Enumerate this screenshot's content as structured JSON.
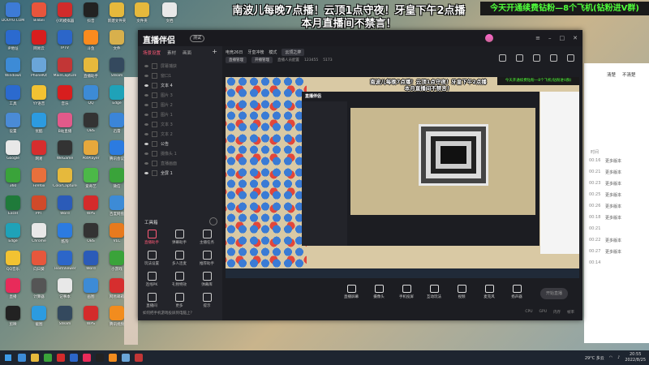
{
  "desktop": {
    "icons": [
      {
        "label": "DOUYU.COM",
        "color": "#3d7bd6"
      },
      {
        "label": "Bilibili",
        "color": "#e8553c"
      },
      {
        "label": "小鸡模拟器",
        "color": "#d12b2b"
      },
      {
        "label": "抖音",
        "color": "#222"
      },
      {
        "label": "新建文件夹",
        "color": "#e6b93c"
      },
      {
        "label": "IP地址",
        "color": "#2b6acf"
      },
      {
        "label": "网易云",
        "color": "#d81e1e"
      },
      {
        "label": "IPTV",
        "color": "#2c66c9"
      },
      {
        "label": "斗鱼",
        "color": "#fb8b1e"
      },
      {
        "label": "文件",
        "color": "#d8b04c"
      },
      {
        "label": "Windows",
        "color": "#3d8bd6"
      },
      {
        "label": "PhoneKit",
        "color": "#6aa5d8"
      },
      {
        "label": "MainCapture",
        "color": "#c23636"
      },
      {
        "label": "直播助手",
        "color": "#e6b93c"
      },
      {
        "label": "Steam",
        "color": "#34495e"
      },
      {
        "label": "工具",
        "color": "#2b6acf"
      },
      {
        "label": "YY语音",
        "color": "#f2c232"
      },
      {
        "label": "音乐",
        "color": "#d81e1e"
      },
      {
        "label": "QQ",
        "color": "#3d8bd6"
      },
      {
        "label": "Edge",
        "color": "#1fa2b8"
      },
      {
        "label": "设置",
        "color": "#4a8bd6"
      },
      {
        "label": "优酷",
        "color": "#2c9be0"
      },
      {
        "label": "B站直播",
        "color": "#e25a8a"
      },
      {
        "label": "OBS",
        "color": "#333"
      },
      {
        "label": "迅雷",
        "color": "#3b85d8"
      },
      {
        "label": "Google",
        "color": "#e8e8e8"
      },
      {
        "label": "网易",
        "color": "#d62e2e"
      },
      {
        "label": "WeGame",
        "color": "#333"
      },
      {
        "label": "PotPlayer",
        "color": "#e6a83c"
      },
      {
        "label": "腾讯会议",
        "color": "#2c7be0"
      },
      {
        "label": "360",
        "color": "#3aa33a"
      },
      {
        "label": "Firefox",
        "color": "#e8703c"
      },
      {
        "label": "ColorCapture",
        "color": "#e6b93c"
      },
      {
        "label": "爱奇艺",
        "color": "#4cb848"
      },
      {
        "label": "微信",
        "color": "#3aa33a"
      },
      {
        "label": "Excel",
        "color": "#1f7a3a"
      },
      {
        "label": "PPT",
        "color": "#d04a2a"
      },
      {
        "label": "Word",
        "color": "#2b5bb8"
      },
      {
        "label": "WPS",
        "color": "#d42b2b"
      },
      {
        "label": "百度网盘",
        "color": "#3d8bd6"
      },
      {
        "label": "Edge",
        "color": "#1fa2b8"
      },
      {
        "label": "Chrome",
        "color": "#e8e8e8"
      },
      {
        "label": "酷狗",
        "color": "#2c7be0"
      },
      {
        "label": "OBS",
        "color": "#333"
      },
      {
        "label": "VLC",
        "color": "#e87a1e"
      },
      {
        "label": "QQ音乐",
        "color": "#f2c232"
      },
      {
        "label": "向日葵",
        "color": "#e6573c"
      },
      {
        "label": "TeamViewer",
        "color": "#2c66c9"
      },
      {
        "label": "Word",
        "color": "#2b5bb8"
      },
      {
        "label": "小游戏",
        "color": "#3aa33a"
      },
      {
        "label": "直播",
        "color": "#e82b5a"
      },
      {
        "label": "计算器",
        "color": "#555"
      },
      {
        "label": "记事本",
        "color": "#e8e8e8"
      },
      {
        "label": "画图",
        "color": "#3d8bd6"
      },
      {
        "label": "网易邮箱",
        "color": "#d62e2e"
      },
      {
        "label": "剪映",
        "color": "#222"
      },
      {
        "label": "截图",
        "color": "#2c9be0"
      },
      {
        "label": "Steam",
        "color": "#34495e"
      },
      {
        "label": "WPS",
        "color": "#d42b2b"
      },
      {
        "label": "腾讯视频",
        "color": "#f28c1e"
      }
    ],
    "top_icons": [
      {
        "label": "文件夹",
        "color": "#e6b93c"
      },
      {
        "label": "文档",
        "color": "#e8e8e8"
      }
    ]
  },
  "banner": {
    "line1": "南波儿每晚7点播！云顶1点守夜！牙皇下午2点播",
    "line2": "本月直播间不禁言！",
    "green": "今天开通续费钻粉—8个飞机(钻粉进V群)"
  },
  "side_panel": {
    "tabs": [
      "清楚",
      "不清楚"
    ],
    "label": "时间",
    "rows": [
      {
        "time": "00:16",
        "text": "更多版本"
      },
      {
        "time": "00:21",
        "text": "更多版本"
      },
      {
        "time": "00:23",
        "text": "更多版本"
      },
      {
        "time": "00:25",
        "text": "更多版本"
      },
      {
        "time": "00:26",
        "text": "更多版本"
      },
      {
        "time": "00:18",
        "text": "更多版本"
      },
      {
        "time": "00:21",
        "text": ""
      },
      {
        "time": "00:22",
        "text": "更多版本"
      },
      {
        "time": "00:27",
        "text": "更多版本"
      },
      {
        "time": "00:14",
        "text": ""
      }
    ]
  },
  "app": {
    "logo": "直播伴侣",
    "badge": "测试",
    "scene_tabs": [
      "场景设置",
      "素材",
      "画面"
    ],
    "scenes": [
      {
        "label": "屏幕捕获",
        "on": false
      },
      {
        "label": "窗口1",
        "on": false
      },
      {
        "label": "文本 4",
        "on": true
      },
      {
        "label": "图片 3",
        "on": false
      },
      {
        "label": "图片 2",
        "on": false
      },
      {
        "label": "图片 1",
        "on": false
      },
      {
        "label": "文本 3",
        "on": false
      },
      {
        "label": "文本 2",
        "on": false
      },
      {
        "label": "公告",
        "on": true
      },
      {
        "label": "摄像头 1",
        "on": false
      },
      {
        "label": "直播画面",
        "on": false
      },
      {
        "label": "全屏 1",
        "on": true
      }
    ],
    "tools_title": "工具箱",
    "tools": [
      {
        "label": "直播助手",
        "hot": true
      },
      {
        "label": "弹幕助手",
        "hot": false
      },
      {
        "label": "主播任务",
        "hot": false
      },
      {
        "label": "玩法设置",
        "hot": false
      },
      {
        "label": "多人连麦",
        "hot": false
      },
      {
        "label": "推荐助手",
        "hot": false
      },
      {
        "label": "连线PK",
        "hot": false
      },
      {
        "label": "礼物特效",
        "hot": false
      },
      {
        "label": "弹幕库",
        "hot": false
      },
      {
        "label": "直播间",
        "hot": false
      },
      {
        "label": "更多",
        "hot": false
      },
      {
        "label": "提示",
        "hot": false
      }
    ],
    "scene_footer": "如何把手机游戏投屏到电脑上？",
    "info": {
      "row1": [
        "电竞26日",
        "牙皇冲榜",
        "模式",
        "云顶之弈"
      ],
      "row2": [
        "直播管理",
        "开播管理",
        "直播人员配置",
        "123455",
        "5173"
      ]
    },
    "preview": {
      "banner_line1": "南波儿每晚7点播！云顶1点守夜！牙皇下午2点播",
      "banner_line2": "本月直播间不禁言！",
      "green": "今天开通续费钻粉—8个飞机(钻粉进V群)",
      "app_title": "直播伴侣"
    },
    "controls": [
      {
        "label": "直播屏幕"
      },
      {
        "label": "摄像头"
      },
      {
        "label": "手机投屏"
      },
      {
        "label": "互动玩法"
      },
      {
        "label": "视频"
      },
      {
        "label": "麦克风"
      },
      {
        "label": "扬声器"
      }
    ],
    "start_label": "开始直播",
    "status": [
      "CPU",
      "GPU",
      "内存",
      "帧率"
    ]
  },
  "taskbar": {
    "apps": [
      "#3d8bd6",
      "#e6b93c",
      "#3aa33a",
      "#d42b2b",
      "#2c66c9",
      "#e82b5a",
      "#222",
      "#f28c1e",
      "#6aa5d8",
      "#c23636"
    ],
    "weather": "29°C 多云",
    "time": "20:55",
    "date": "2022/8/25"
  }
}
